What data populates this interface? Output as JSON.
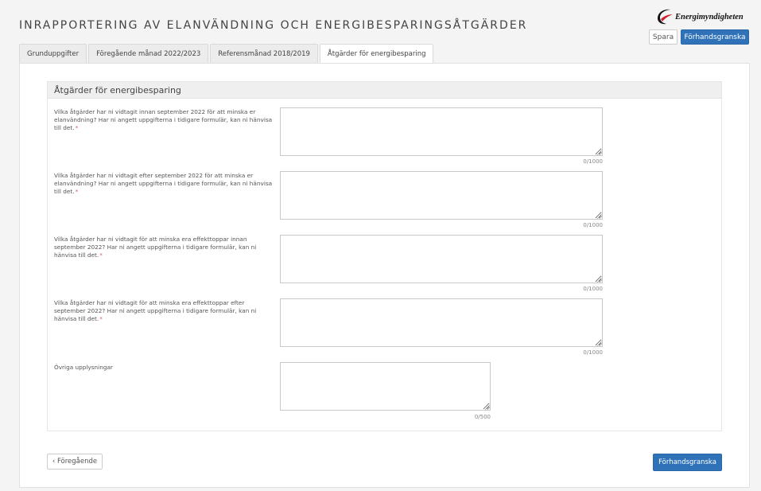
{
  "header": {
    "title": "INRAPPORTERING AV ELANVÄNDNING OCH ENERGIBESPARINGSÅTGÄRDER",
    "logo_text": "Energimyndigheten",
    "save_label": "Spara",
    "preview_label": "Förhandsgranska"
  },
  "tabs": [
    {
      "label": "Grunduppgifter"
    },
    {
      "label": "Föregående månad 2022/2023"
    },
    {
      "label": "Referensmånad 2018/2019"
    },
    {
      "label": "Åtgärder för energibesparing",
      "active": true
    }
  ],
  "section": {
    "title": "Åtgärder för energibesparing",
    "questions": [
      {
        "label": "Vilka åtgärder har ni vidtagit innan september 2022 för att minska er elanvändning? Har ni angett uppgifterna i tidigare formulär, kan ni hänvisa till det.",
        "required": "*",
        "value": "",
        "counter": "0/1000"
      },
      {
        "label": "Vilka åtgärder har ni vidtagit efter september 2022 för att minska er elanvändning? Har ni angett uppgifterna i tidigare formulär, kan ni hänvisa till det.",
        "required": "*",
        "value": "",
        "counter": "0/1000"
      },
      {
        "label": "Vilka åtgärder har ni vidtagit för att minska era effekttoppar innan september 2022? Har ni angett uppgifterna i tidigare formulär, kan ni hänvisa till det.",
        "required": "*",
        "value": "",
        "counter": "0/1000"
      },
      {
        "label": "Vilka åtgärder har ni vidtagit för att minska era effekttoppar efter september 2022? Har ni angett uppgifterna i tidigare formulär, kan ni hänvisa till det.",
        "required": "*",
        "value": "",
        "counter": "0/1000"
      },
      {
        "label": "Övriga upplysningar",
        "required": "",
        "value": "",
        "counter": "0/500"
      }
    ]
  },
  "footer": {
    "prev_label": "‹ Föregående",
    "preview_label": "Förhandsgranska"
  },
  "colors": {
    "primary": "#2f72b8",
    "required": "#d9534f",
    "logo_red": "#d0202e"
  },
  "icons": {
    "logo": "energimyndigheten-swoosh-icon"
  }
}
